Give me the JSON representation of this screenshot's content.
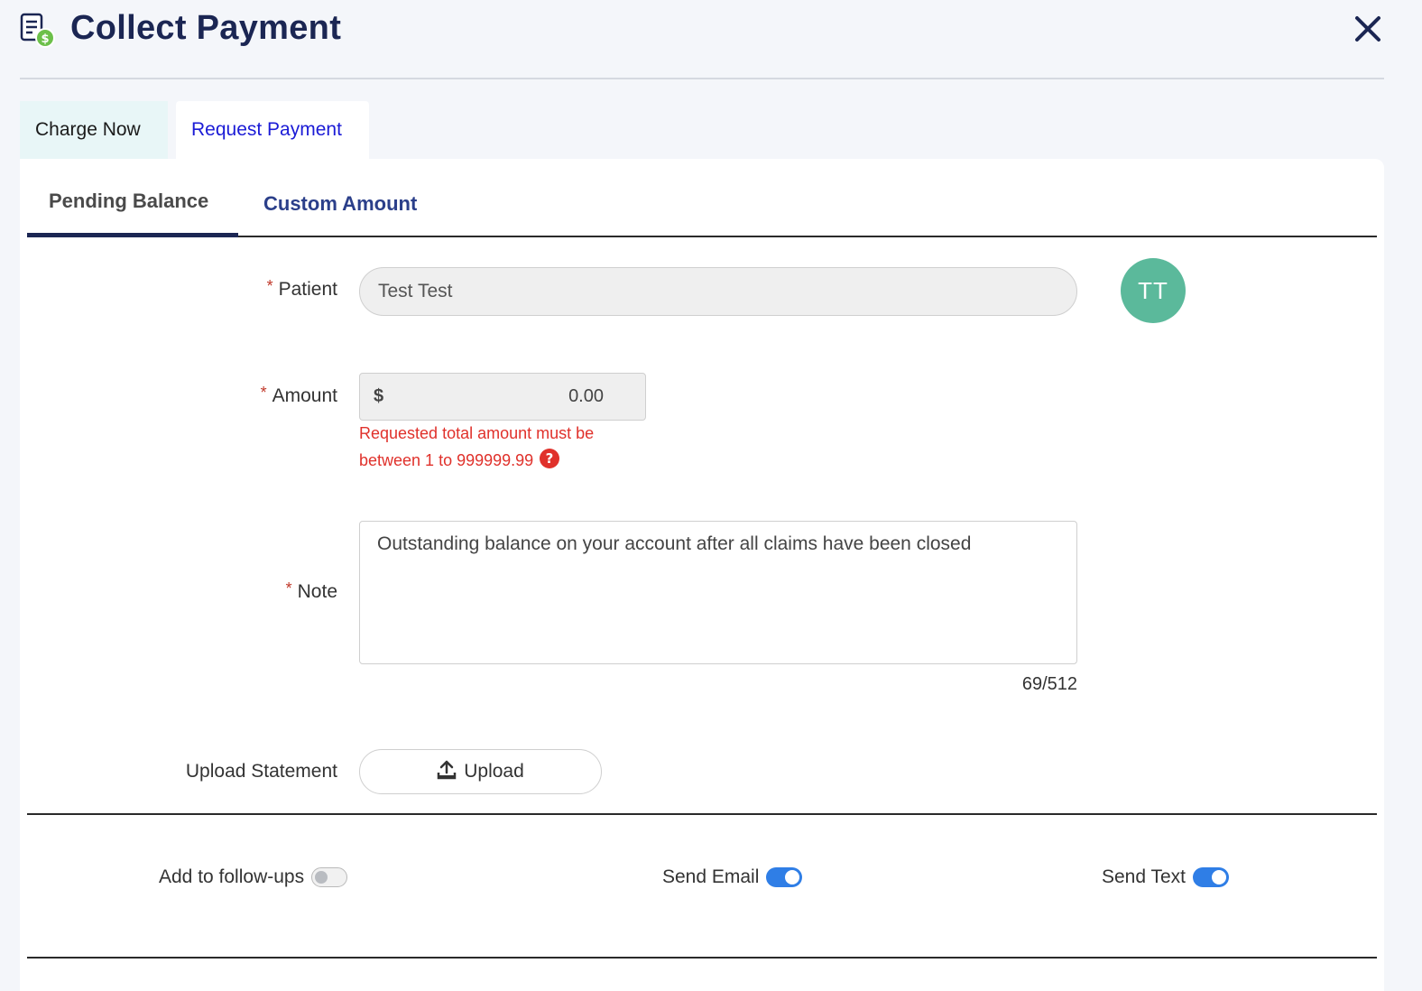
{
  "header": {
    "title": "Collect Payment",
    "title_icon": "invoice-dollar-icon",
    "close_icon": "close-icon"
  },
  "tabs": [
    {
      "label": "Charge Now",
      "active": false
    },
    {
      "label": "Request Payment",
      "active": true
    }
  ],
  "subtabs": [
    {
      "label": "Pending Balance",
      "active": true
    },
    {
      "label": "Custom Amount",
      "active": false
    }
  ],
  "form": {
    "required_marker": "*",
    "patient": {
      "label": "Patient",
      "value": "Test Test",
      "avatar_initials": "TT",
      "avatar_color": "#5bb99b"
    },
    "amount": {
      "label": "Amount",
      "currency": "$",
      "value": "0.00",
      "error": "Requested total amount must be between 1 to 999999.99",
      "error_color": "#e0312b"
    },
    "note": {
      "label": "Note",
      "value": "Outstanding balance on your account after all claims have been closed",
      "char_count": "69/512"
    },
    "upload": {
      "label": "Upload Statement",
      "button_label": "Upload",
      "icon": "upload-icon"
    }
  },
  "toggles": [
    {
      "label": "Add to follow-ups",
      "on": false
    },
    {
      "label": "Send Email",
      "on": true
    },
    {
      "label": "Send Text",
      "on": true
    }
  ],
  "colors": {
    "accent": "#2f7ee6",
    "title": "#1b2653",
    "link": "#1b1bd6"
  }
}
